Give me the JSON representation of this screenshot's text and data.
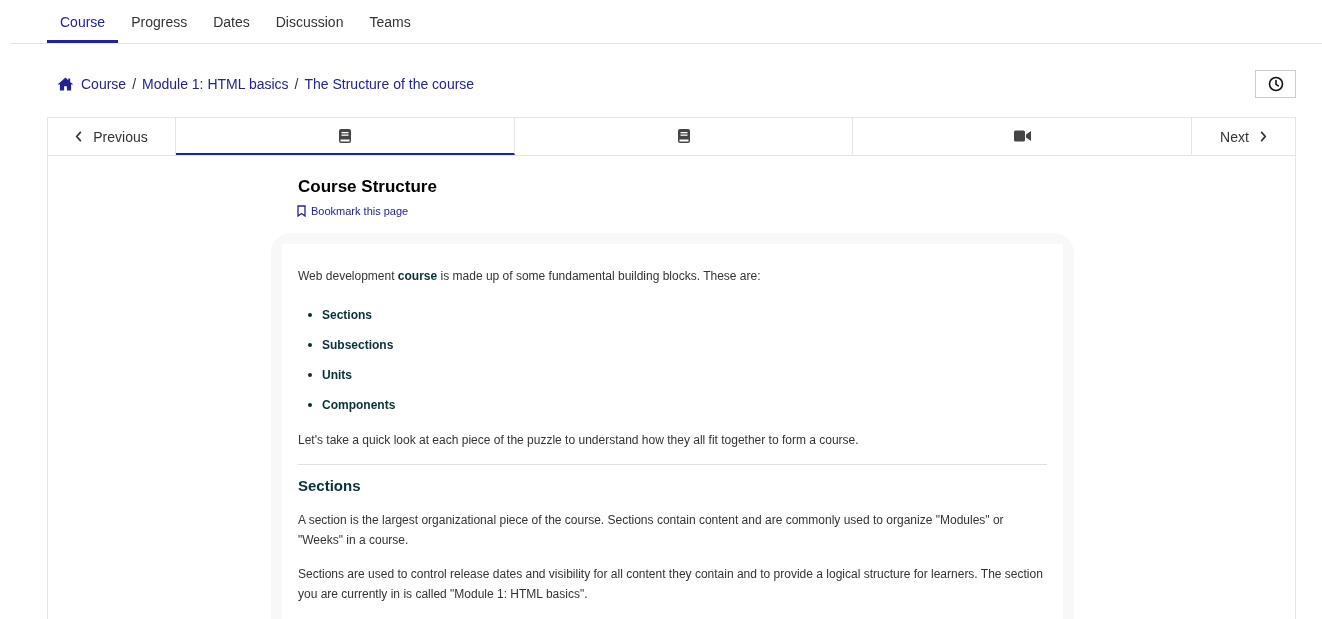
{
  "course_tabs": [
    {
      "label": "Course",
      "selected": true
    },
    {
      "label": "Progress",
      "selected": false
    },
    {
      "label": "Dates",
      "selected": false
    },
    {
      "label": "Discussion",
      "selected": false
    },
    {
      "label": "Teams",
      "selected": false
    }
  ],
  "breadcrumb": [
    {
      "kind": "link",
      "text": "Course"
    },
    {
      "kind": "separator",
      "text": "/"
    },
    {
      "kind": "link",
      "text": "Module 1: HTML basics"
    },
    {
      "kind": "separator",
      "text": "/"
    },
    {
      "kind": "link",
      "text": "The Structure of the course"
    }
  ],
  "sequence_nav": {
    "previous": "Previous",
    "next": "Next",
    "units": [
      {
        "kind": "book",
        "selected": true
      },
      {
        "kind": "book",
        "selected": false
      },
      {
        "kind": "video",
        "selected": false
      }
    ]
  },
  "unit": {
    "title": "Course Structure",
    "bookmark": "Bookmark this page",
    "content": [
      {
        "kind": "paragraph",
        "text": "Web development **course** is made up of some fundamental building blocks. These are:"
      },
      {
        "kind": "list",
        "items": [
          "Sections",
          "Subsections",
          "Units",
          "Components"
        ]
      },
      {
        "kind": "paragraph",
        "text": "Let's take a quick look at each piece of the puzzle to understand how they all fit together to form a course."
      },
      {
        "kind": "divider"
      },
      {
        "kind": "heading",
        "text": "Sections"
      },
      {
        "kind": "paragraph",
        "text": "A section is the largest organizational piece of the course. Sections contain content and are commonly used to organize \"Modules\" or \"Weeks\" in a course."
      },
      {
        "kind": "paragraph",
        "text": "Sections are used to control release dates and visibility for all content they contain and to provide a logical structure for learners. The section you are currently in is called \"Module 1: HTML basics\"."
      }
    ]
  }
}
